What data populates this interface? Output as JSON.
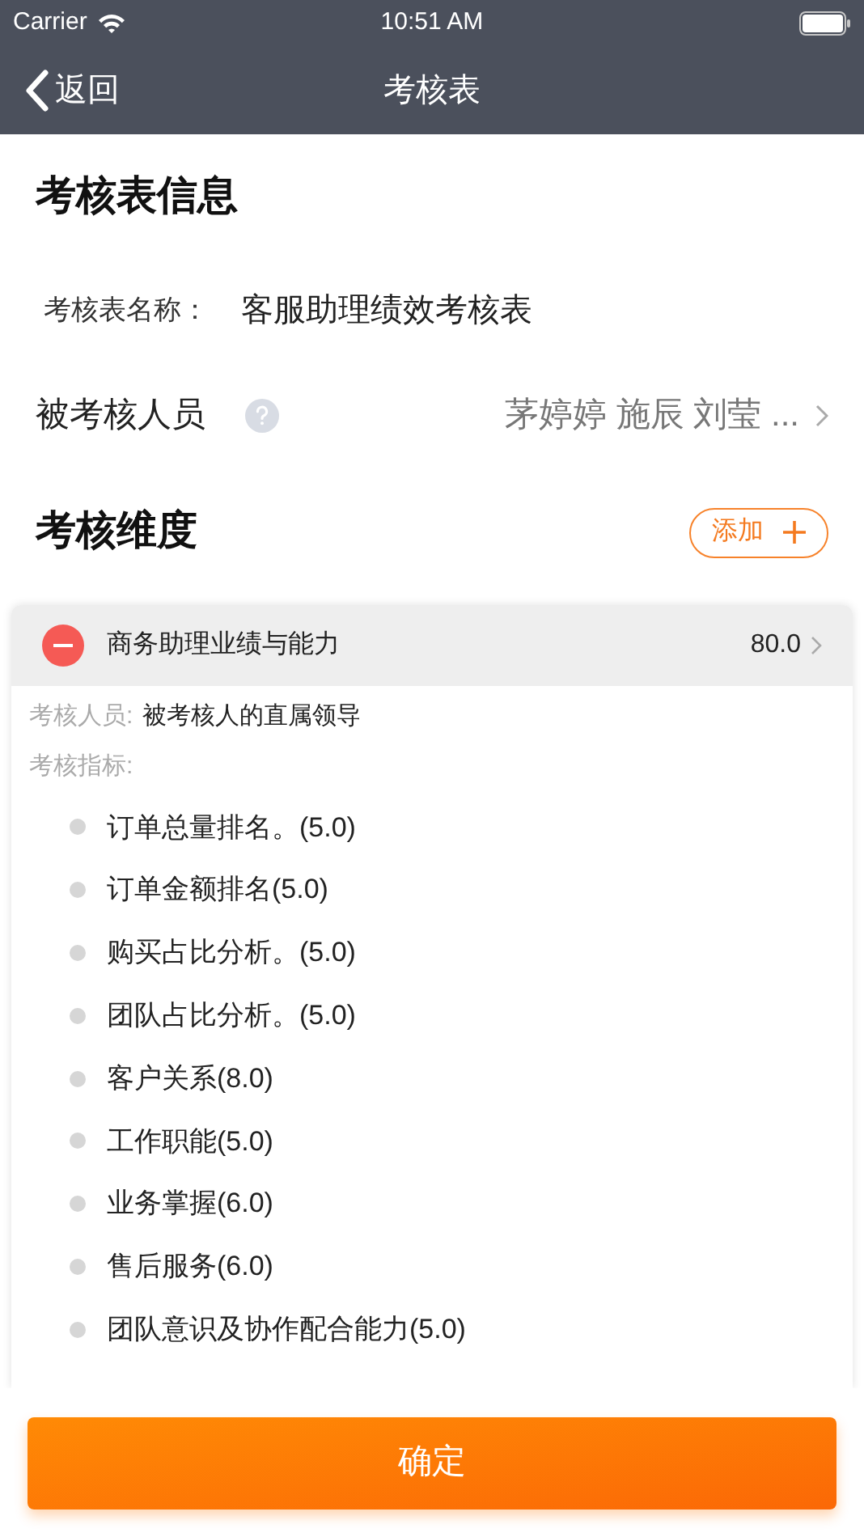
{
  "status_bar": {
    "carrier": "Carrier",
    "time": "10:51 AM"
  },
  "nav": {
    "back": "返回",
    "title": "考核表"
  },
  "info": {
    "heading": "考核表信息",
    "name_label": "考核表名称：",
    "name_value": "客服助理绩效考核表",
    "persons_label": "被考核人员",
    "persons_value": "茅婷婷 施辰 刘莹 ..."
  },
  "dimensions": {
    "heading": "考核维度",
    "add_button": "添加",
    "items": [
      {
        "title": "商务助理业绩与能力",
        "score": "80.0",
        "reviewer_label": "考核人员:",
        "reviewer": "被考核人的直属领导",
        "indicators_label": "考核指标:",
        "indicators": [
          "订单总量排名。(5.0)",
          "订单金额排名(5.0)",
          "购买占比分析。(5.0)",
          "团队占比分析。(5.0)",
          "客户关系(8.0)",
          "工作职能(5.0)",
          "业务掌握(6.0)",
          "售后服务(6.0)",
          "团队意识及协作配合能力(5.0)"
        ]
      }
    ]
  },
  "confirm_button": "确定"
}
